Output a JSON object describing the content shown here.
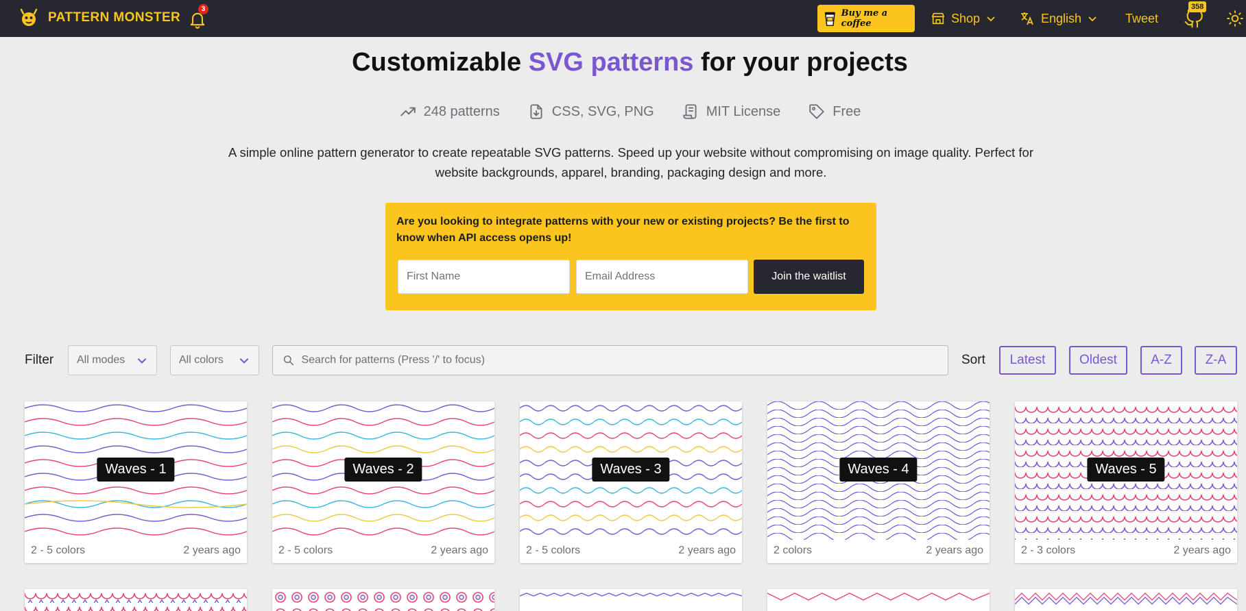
{
  "nav": {
    "brand": "PATTERN MONSTER",
    "notification_count": "3",
    "coffee": "Buy me a coffee",
    "shop": "Shop",
    "language": "English",
    "tweet": "Tweet",
    "github_stars": "358",
    "colors": {
      "bar": "#27272f",
      "accent": "#f9c51e"
    }
  },
  "hero": {
    "title_before": "Customizable ",
    "title_accent": "SVG patterns",
    "title_after": " for your projects",
    "accent_color": "#7a57d1",
    "stats": [
      {
        "icon": "trending-up-icon",
        "label": "248 patterns"
      },
      {
        "icon": "file-download-icon",
        "label": "CSS, SVG, PNG"
      },
      {
        "icon": "license-scroll-icon",
        "label": "MIT License"
      },
      {
        "icon": "price-tag-icon",
        "label": "Free"
      }
    ],
    "description": "A simple online pattern generator to create repeatable SVG patterns. Speed up your website without compromising on image quality. Perfect for website backgrounds, apparel, branding, packaging design and more."
  },
  "waitlist": {
    "text": "Are you looking to integrate patterns with your new or existing projects? Be the first to know when API access opens up!",
    "first_name_placeholder": "First Name",
    "email_placeholder": "Email Address",
    "button": "Join the waitlist"
  },
  "filters": {
    "label": "Filter",
    "mode_value": "All modes",
    "color_value": "All colors",
    "search_placeholder": "Search for patterns (Press '/' to focus)",
    "sort_label": "Sort",
    "sort_options": [
      "Latest",
      "Oldest",
      "A-Z",
      "Z-A"
    ]
  },
  "patterns": [
    {
      "title": "Waves - 1",
      "colors": "2 - 5 colors",
      "age": "2 years ago"
    },
    {
      "title": "Waves - 2",
      "colors": "2 - 5 colors",
      "age": "2 years ago"
    },
    {
      "title": "Waves - 3",
      "colors": "2 - 5 colors",
      "age": "2 years ago"
    },
    {
      "title": "Waves - 4",
      "colors": "2 colors",
      "age": "2 years ago"
    },
    {
      "title": "Waves - 5",
      "colors": "2 - 3 colors",
      "age": "2 years ago"
    }
  ]
}
